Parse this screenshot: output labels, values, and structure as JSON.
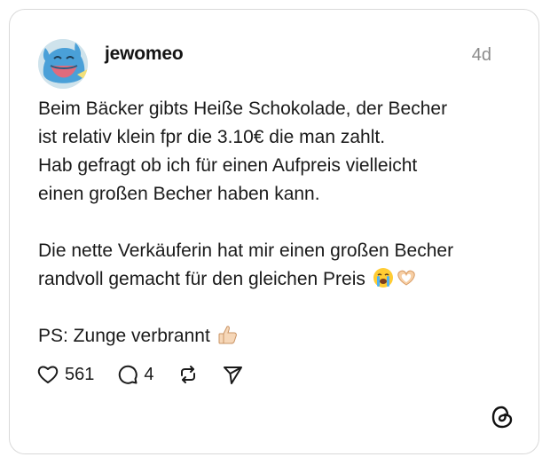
{
  "post": {
    "username": "jewomeo",
    "timestamp": "4d",
    "avatar_icon": "blue-creature-avatar",
    "paragraphs": [
      [
        "Beim Bäcker gibts Heiße Schokolade, der Becher",
        "ist relativ klein fpr die 3.10€ die man zahlt.",
        "Hab gefragt ob ich für einen Aufpreis vielleicht",
        "einen großen Becher haben kann."
      ],
      [
        "Die nette Verkäuferin hat mir einen großen Becher",
        "randvoll gemacht für den gleichen Preis"
      ],
      [
        "PS: Zunge verbrannt"
      ]
    ],
    "emojis": {
      "p2_line2": [
        "crying-face-emoji",
        "heart-hands-emoji"
      ],
      "p3_line1": [
        "thumbs-up-emoji"
      ]
    }
  },
  "actions": {
    "like_count": "561",
    "reply_count": "4"
  },
  "icons": {
    "like": "heart-icon",
    "reply": "comment-icon",
    "repost": "repost-icon",
    "share": "send-icon",
    "brand": "threads-logo-icon"
  },
  "colors": {
    "text": "#1a1a1a",
    "muted": "#8a8a8a",
    "border": "#d9d9d9"
  }
}
